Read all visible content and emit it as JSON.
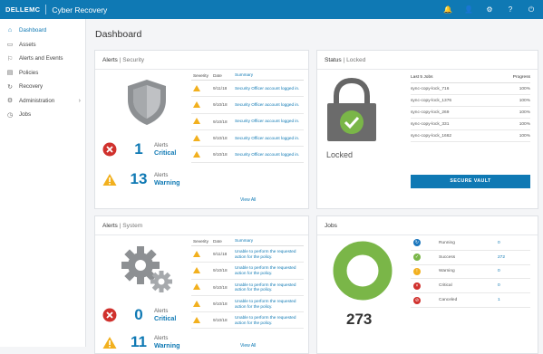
{
  "header": {
    "logo": "DELLEMC",
    "title": "Cyber Recovery"
  },
  "top_icons": [
    {
      "name": "bell-icon",
      "glyph": "🔔"
    },
    {
      "name": "user-icon",
      "glyph": "👤"
    },
    {
      "name": "gear-icon",
      "glyph": "⚙"
    },
    {
      "name": "help-icon",
      "glyph": "?"
    },
    {
      "name": "power-icon",
      "glyph": "⏻"
    }
  ],
  "sidebar": {
    "items": [
      {
        "label": "Dashboard",
        "icon": "home-icon",
        "glyph": "⌂",
        "active": true
      },
      {
        "label": "Assets",
        "icon": "assets-icon",
        "glyph": "▭"
      },
      {
        "label": "Alerts and Events",
        "icon": "alerts-icon",
        "glyph": "⚐"
      },
      {
        "label": "Policies",
        "icon": "policies-icon",
        "glyph": "▤"
      },
      {
        "label": "Recovery",
        "icon": "recovery-icon",
        "glyph": "↻"
      },
      {
        "label": "Administration",
        "icon": "admin-icon",
        "glyph": "⚙",
        "chevron": "›"
      },
      {
        "label": "Jobs",
        "icon": "jobs-icon",
        "glyph": "◷"
      }
    ]
  },
  "page_title": "Dashboard",
  "alerts_security": {
    "title": "Alerts",
    "subtitle": "Security",
    "critical": {
      "count": "1",
      "label": "Alerts",
      "level": "Critical"
    },
    "warning": {
      "count": "13",
      "label": "Alerts",
      "level": "Warning"
    },
    "columns": [
      "Severity",
      "Date",
      "Summary"
    ],
    "rows": [
      {
        "date": "9/11/18",
        "summary": "Security Officer account logged in."
      },
      {
        "date": "9/10/18",
        "summary": "Security Officer account logged in."
      },
      {
        "date": "9/10/18",
        "summary": "Security Officer account logged in."
      },
      {
        "date": "9/10/18",
        "summary": "Security Officer account logged in."
      },
      {
        "date": "9/10/18",
        "summary": "Security Officer account logged in."
      }
    ],
    "view_all": "View All"
  },
  "alerts_system": {
    "title": "Alerts",
    "subtitle": "System",
    "critical": {
      "count": "0",
      "label": "Alerts",
      "level": "Critical"
    },
    "warning": {
      "count": "11",
      "label": "Alerts",
      "level": "Warning"
    },
    "columns": [
      "Severity",
      "Date",
      "Summary"
    ],
    "rows": [
      {
        "date": "9/11/18",
        "summary": "Unable to perform the requested action for the policy."
      },
      {
        "date": "9/10/18",
        "summary": "Unable to perform the requested action for the policy."
      },
      {
        "date": "9/10/18",
        "summary": "Unable to perform the requested action for the policy."
      },
      {
        "date": "9/10/18",
        "summary": "Unable to perform the requested action for the policy."
      },
      {
        "date": "9/10/18",
        "summary": "Unable to perform the requested action for the policy."
      }
    ],
    "view_all": "View All"
  },
  "status": {
    "title": "Status",
    "subtitle": "Locked",
    "state": "Locked",
    "columns": [
      "Last 5 Jobs",
      "Progress"
    ],
    "jobs": [
      {
        "name": "sync-copy-lock_716",
        "progress": "100%"
      },
      {
        "name": "sync-copy-lock_1376",
        "progress": "100%"
      },
      {
        "name": "sync-copy-lock_269",
        "progress": "100%"
      },
      {
        "name": "sync-copy-lock_331",
        "progress": "100%"
      },
      {
        "name": "sync-copy-lock_1662",
        "progress": "100%"
      }
    ],
    "button": "SECURE VAULT"
  },
  "jobs": {
    "title": "Jobs",
    "total": "273",
    "statuses": [
      {
        "label": "Running",
        "value": "0",
        "color": "#1a76bd",
        "glyph": "↻",
        "icon": "running-icon"
      },
      {
        "label": "Success",
        "value": "272",
        "color": "#7ab648",
        "glyph": "✓",
        "icon": "success-icon"
      },
      {
        "label": "Warning",
        "value": "0",
        "color": "#f2b01e",
        "glyph": "!",
        "icon": "warning-icon"
      },
      {
        "label": "Critical",
        "value": "0",
        "color": "#d0312d",
        "glyph": "×",
        "icon": "critical-icon"
      },
      {
        "label": "Canceled",
        "value": "1",
        "color": "#d0312d",
        "glyph": "⊘",
        "icon": "canceled-icon"
      }
    ]
  }
}
